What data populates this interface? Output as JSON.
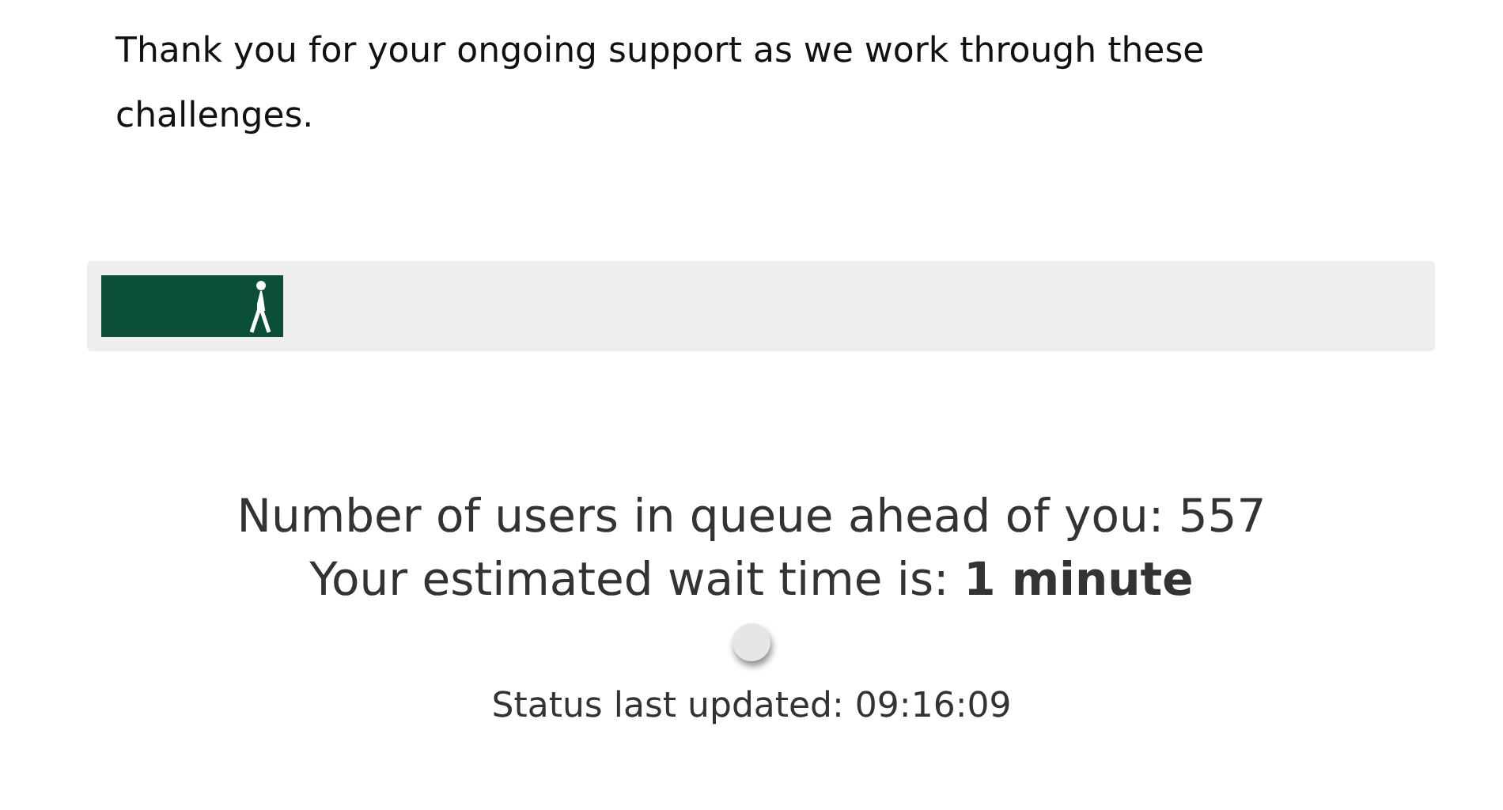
{
  "message": "Thank you for your ongoing support as we work through these challenges.",
  "progress": {
    "level": 0.138
  },
  "queue_text": "Number of users in queue ahead of you: 557",
  "wait_text": "Your estimated wait time is: **1 minute**",
  "status_text": "Status last updated: 09:16:09"
}
